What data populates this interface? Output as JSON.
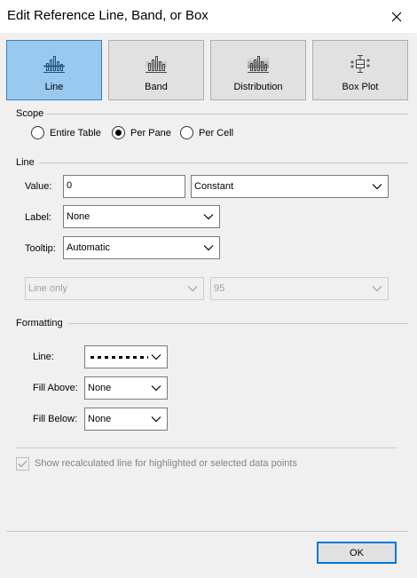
{
  "window": {
    "title": "Edit Reference Line, Band, or Box"
  },
  "types": [
    {
      "label": "Line",
      "selected": true,
      "icon": "line-chart-icon"
    },
    {
      "label": "Band",
      "selected": false,
      "icon": "band-chart-icon"
    },
    {
      "label": "Distribution",
      "selected": false,
      "icon": "distribution-chart-icon"
    },
    {
      "label": "Box Plot",
      "selected": false,
      "icon": "box-plot-icon"
    }
  ],
  "scope": {
    "heading": "Scope",
    "options": [
      {
        "label": "Entire Table",
        "checked": false
      },
      {
        "label": "Per Pane",
        "checked": true
      },
      {
        "label": "Per Cell",
        "checked": false
      }
    ]
  },
  "line": {
    "heading": "Line",
    "value_label": "Value:",
    "value": "0",
    "value_mode": "Constant",
    "label_label": "Label:",
    "label_value": "None",
    "tooltip_label": "Tooltip:",
    "tooltip_value": "Automatic",
    "confidence_type": "Line only",
    "confidence_value": "95"
  },
  "formatting": {
    "heading": "Formatting",
    "line_label": "Line:",
    "fill_above_label": "Fill Above:",
    "fill_above_value": "None",
    "fill_below_label": "Fill Below:",
    "fill_below_value": "None"
  },
  "recalc": {
    "label": "Show recalculated line for highlighted or selected data points",
    "checked": true,
    "disabled": true
  },
  "footer": {
    "ok_label": "OK"
  },
  "colors": {
    "selected_fill": "#99c9ef",
    "selected_border": "#3c7fb1",
    "dialog_bg": "#f0f0f0",
    "focus_border": "#0078d7"
  }
}
